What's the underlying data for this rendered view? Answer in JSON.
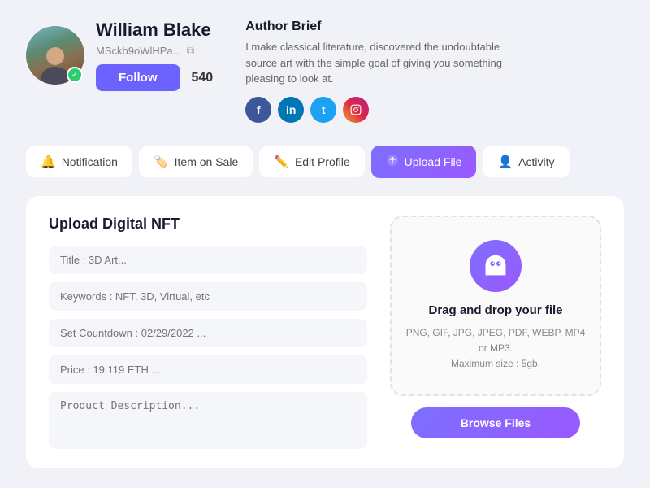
{
  "profile": {
    "name": "William Blake",
    "wallet": "MSckb9oWlHPa...",
    "follower_count": "540",
    "follow_label": "Follow",
    "verified": "✓"
  },
  "author": {
    "title": "Author Brief",
    "description": "I make classical literature, discovered the undoubtable source art with the simple goal of giving you something pleasing to look at.",
    "socials": [
      {
        "name": "Facebook",
        "abbr": "f",
        "class": "social-fb"
      },
      {
        "name": "LinkedIn",
        "abbr": "in",
        "class": "social-li"
      },
      {
        "name": "Twitter",
        "abbr": "t",
        "class": "social-tw"
      },
      {
        "name": "Instagram",
        "abbr": "ig",
        "class": "social-ig"
      }
    ]
  },
  "tabs": [
    {
      "id": "notification",
      "label": "Notification",
      "icon": "🔔",
      "active": false
    },
    {
      "id": "item-on-sale",
      "label": "Item on Sale",
      "icon": "🏷️",
      "active": false
    },
    {
      "id": "edit-profile",
      "label": "Edit Profile",
      "icon": "✏️",
      "active": false
    },
    {
      "id": "upload-file",
      "label": "Upload File",
      "icon": "⬆️",
      "active": true
    },
    {
      "id": "activity",
      "label": "Activity",
      "icon": "👤",
      "active": false
    }
  ],
  "upload": {
    "section_title": "Upload Digital NFT",
    "fields": [
      {
        "id": "title",
        "placeholder": "Title : 3D Art..."
      },
      {
        "id": "keywords",
        "placeholder": "Keywords : NFT, 3D, Virtual, etc"
      },
      {
        "id": "countdown",
        "placeholder": "Set Countdown : 02/29/2022 ..."
      },
      {
        "id": "price",
        "placeholder": "Price : 19.119 ETH ..."
      },
      {
        "id": "description",
        "placeholder": "Product Description...",
        "multiline": true
      }
    ],
    "dropzone": {
      "title": "Drag and drop your file",
      "subtitle": "PNG, GIF, JPG, JPEG, PDF, WEBP, MP4 or MP3.\nMaximum size : 5gb.",
      "browse_label": "Browse Files"
    }
  },
  "colors": {
    "accent": "#6c63ff",
    "accent_gradient_start": "#7c6fff",
    "accent_gradient_end": "#9b59ff",
    "tab_bg": "#ffffff",
    "page_bg": "#f0f2f8"
  }
}
